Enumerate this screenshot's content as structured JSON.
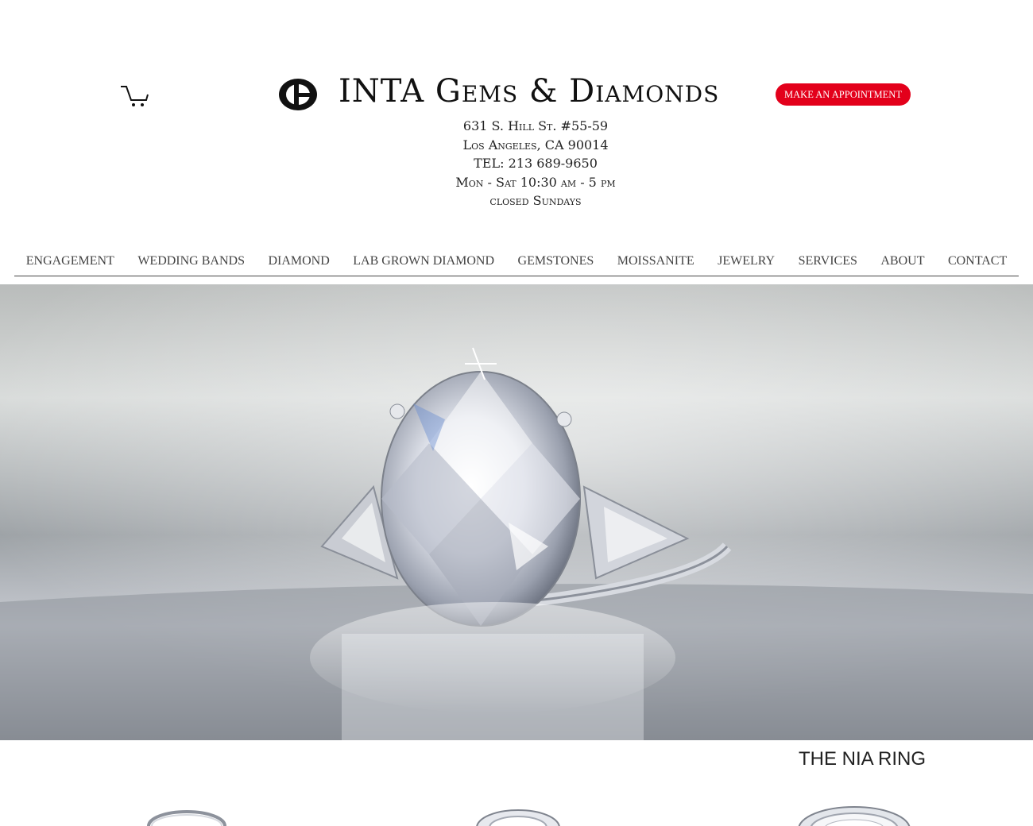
{
  "header": {
    "cart_icon": "cart-icon",
    "logo_icon": "ig-logo-icon",
    "brand_name": "INTA Gems & Diamonds",
    "appointment_button": "MAKE AN APPOINTMENT",
    "accent_color": "#e3001b"
  },
  "address": {
    "street": "631 S. Hill St. #55-59",
    "city": "Los Angeles, CA 90014",
    "phone": "TEL: 213 689-9650",
    "hours": "Mon - Sat 10:30 am - 5 pm",
    "closed": "closed Sundays"
  },
  "nav": {
    "items": [
      {
        "label": "ENGAGEMENT"
      },
      {
        "label": "WEDDING BANDS"
      },
      {
        "label": "DIAMOND"
      },
      {
        "label": "LAB GROWN DIAMOND"
      },
      {
        "label": "GEMSTONES"
      },
      {
        "label": "MOISSANITE"
      },
      {
        "label": "JEWELRY"
      },
      {
        "label": "SERVICES"
      },
      {
        "label": "ABOUT"
      },
      {
        "label": "CONTACT"
      }
    ]
  },
  "section": {
    "title": "THE NIA RING"
  }
}
